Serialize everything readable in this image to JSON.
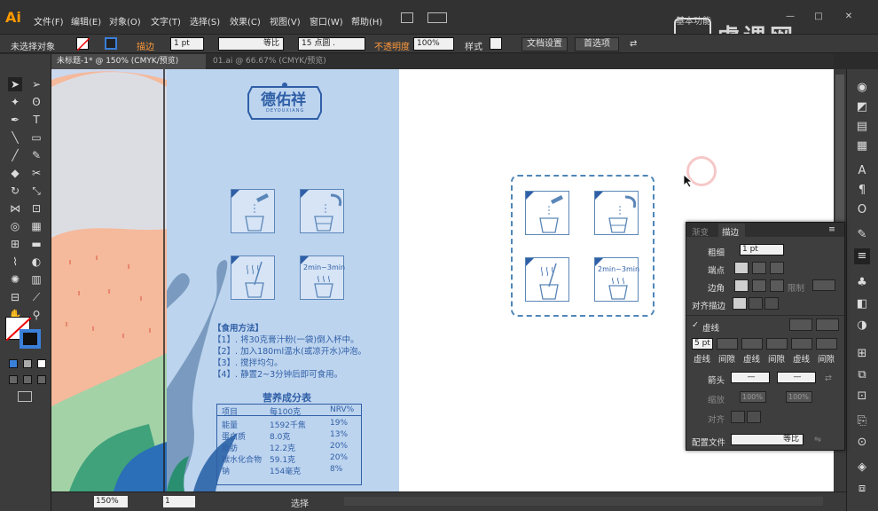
{
  "app": {
    "logo": "Ai"
  },
  "menu": [
    "文件(F)",
    "编辑(E)",
    "对象(O)",
    "文字(T)",
    "选择(S)",
    "效果(C)",
    "视图(V)",
    "窗口(W)",
    "帮助(H)"
  ],
  "workspace": "基本功能",
  "brand": "虎课网",
  "window_controls": {
    "minimize": "—",
    "restore": "□",
    "close": "✕"
  },
  "control_bar": {
    "selection": "未选择对象",
    "stroke_label": "描边",
    "stroke_weight": "1 pt",
    "profile": "等比",
    "brush": "15 点圆 .",
    "opacity_label": "不透明度",
    "opacity_value": "100%",
    "style_label": "样式",
    "doc_settings": "文档设置",
    "preferences": "首选项"
  },
  "tabs": [
    {
      "label": "未标题-1* @ 150% (CMYK/预览)",
      "active": true
    },
    {
      "label": "01.ai @ 66.67% (CMYK/预览)",
      "active": false
    }
  ],
  "package": {
    "logo_text": "德佑祥",
    "logo_sub": "DEYOUXIANG",
    "steps_time": "2min~3min",
    "instructions_title": "【食用方法】",
    "instructions": [
      "【1】. 将30克膏汁粉(一袋)倒入杯中。",
      "【2】. 加入180ml温水(或凉开水)冲泡。",
      "【3】. 搅拌均匀。",
      "【4】. 静置2~3分钟后即可食用。"
    ],
    "nutrition_title": "营养成分表",
    "nutrition_header": [
      "项目",
      "每100克",
      "NRV%"
    ],
    "nutrition_rows": [
      [
        "能量",
        "1592千焦",
        "19%"
      ],
      [
        "蛋白质",
        "8.0克",
        "13%"
      ],
      [
        "脂肪",
        "12.2克",
        "20%"
      ],
      [
        "碳水化合物",
        "59.1克",
        "20%"
      ],
      [
        "钠",
        "154毫克",
        "8%"
      ]
    ]
  },
  "stroke_panel": {
    "tab_gradient": "渐变",
    "tab_stroke": "描边",
    "weight_label": "粗细",
    "weight_value": "1 pt",
    "cap_label": "端点",
    "corner_label": "边角",
    "limit_label": "限制",
    "align_label": "对齐描边",
    "dashed_label": "虚线",
    "dashed_checked": true,
    "dash_value": "5 pt",
    "dash_labels": [
      "虚线",
      "间隙",
      "虚线",
      "间隙",
      "虚线",
      "间隙"
    ],
    "arrow_label": "箭头",
    "scale_label": "缩放",
    "scale_value_1": "100%",
    "scale_value_2": "100%",
    "align2_label": "对齐",
    "profile_label": "配置文件",
    "profile_value": "等比"
  },
  "status": {
    "zoom": "150%",
    "page": "1",
    "tool": "选择"
  }
}
